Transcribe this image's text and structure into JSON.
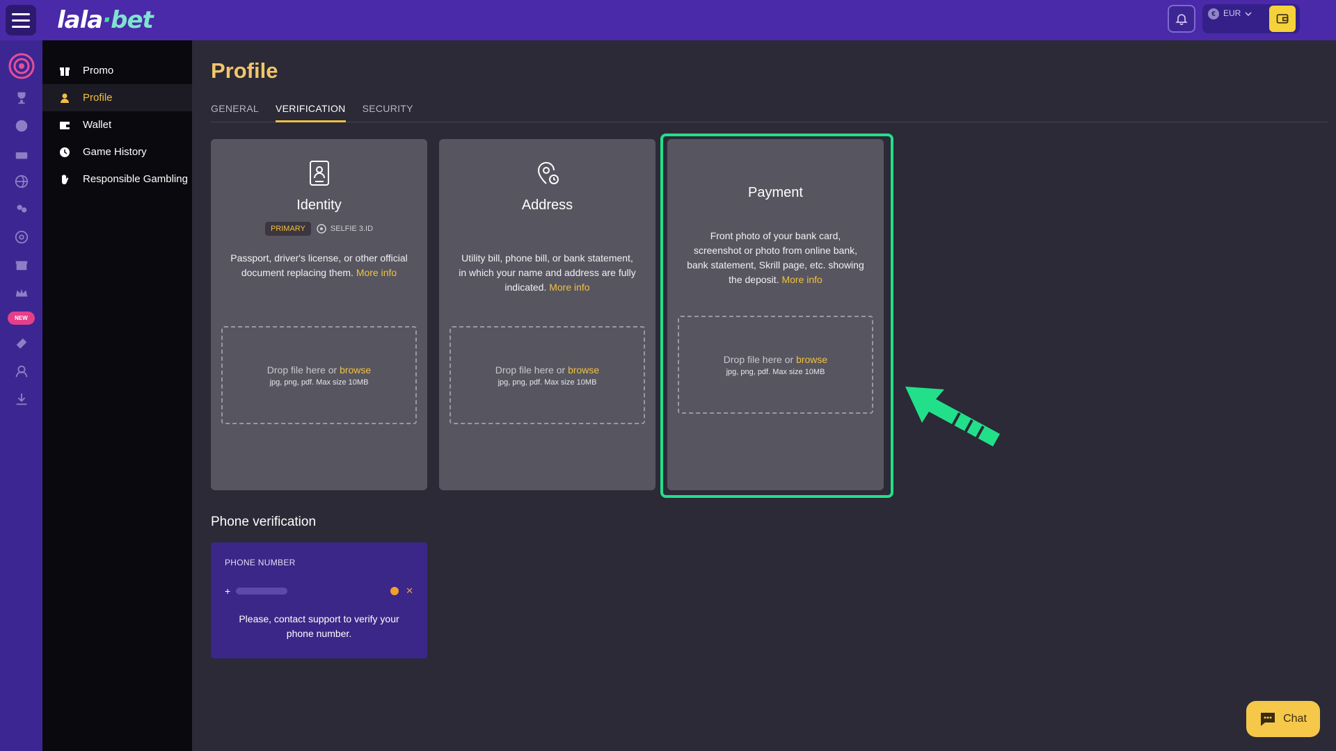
{
  "app": {
    "logo_main": "lala",
    "logo_dot": "·",
    "logo_suffix": "bet"
  },
  "header": {
    "currency": "EUR",
    "currency_symbol": "€"
  },
  "rail": {
    "new_badge": "NEW"
  },
  "sidebar": {
    "items": [
      {
        "label": "Promo"
      },
      {
        "label": "Profile"
      },
      {
        "label": "Wallet"
      },
      {
        "label": "Game History"
      },
      {
        "label": "Responsible Gambling"
      }
    ]
  },
  "page": {
    "title": "Profile",
    "tabs": [
      {
        "label": "GENERAL"
      },
      {
        "label": "VERIFICATION"
      },
      {
        "label": "SECURITY"
      }
    ]
  },
  "cards": {
    "identity": {
      "title": "Identity",
      "badge_primary": "PRIMARY",
      "badge_secondary": "SELFIE 3.ID",
      "desc": "Passport, driver's license, or other official document replacing them.",
      "more": "More info"
    },
    "address": {
      "title": "Address",
      "desc": "Utility bill, phone bill, or bank statement, in which your name and address are fully indicated.",
      "more": "More info"
    },
    "payment": {
      "title": "Payment",
      "desc": "Front photo of your bank card, screenshot or photo from online bank, bank statement, Skrill page, etc. showing the deposit.",
      "more": "More info"
    }
  },
  "dropzone": {
    "text": "Drop file here or",
    "browse": "browse",
    "spec": "jpg, png, pdf. Max size 10MB"
  },
  "phone": {
    "section_title": "Phone verification",
    "label": "PHONE NUMBER",
    "prefix": "+",
    "message": "Please, contact support to verify your phone number."
  },
  "chat": {
    "label": "Chat"
  },
  "colors": {
    "accent": "#f2c040",
    "highlight": "#22e08a",
    "topbar": "#4a2aa8"
  }
}
